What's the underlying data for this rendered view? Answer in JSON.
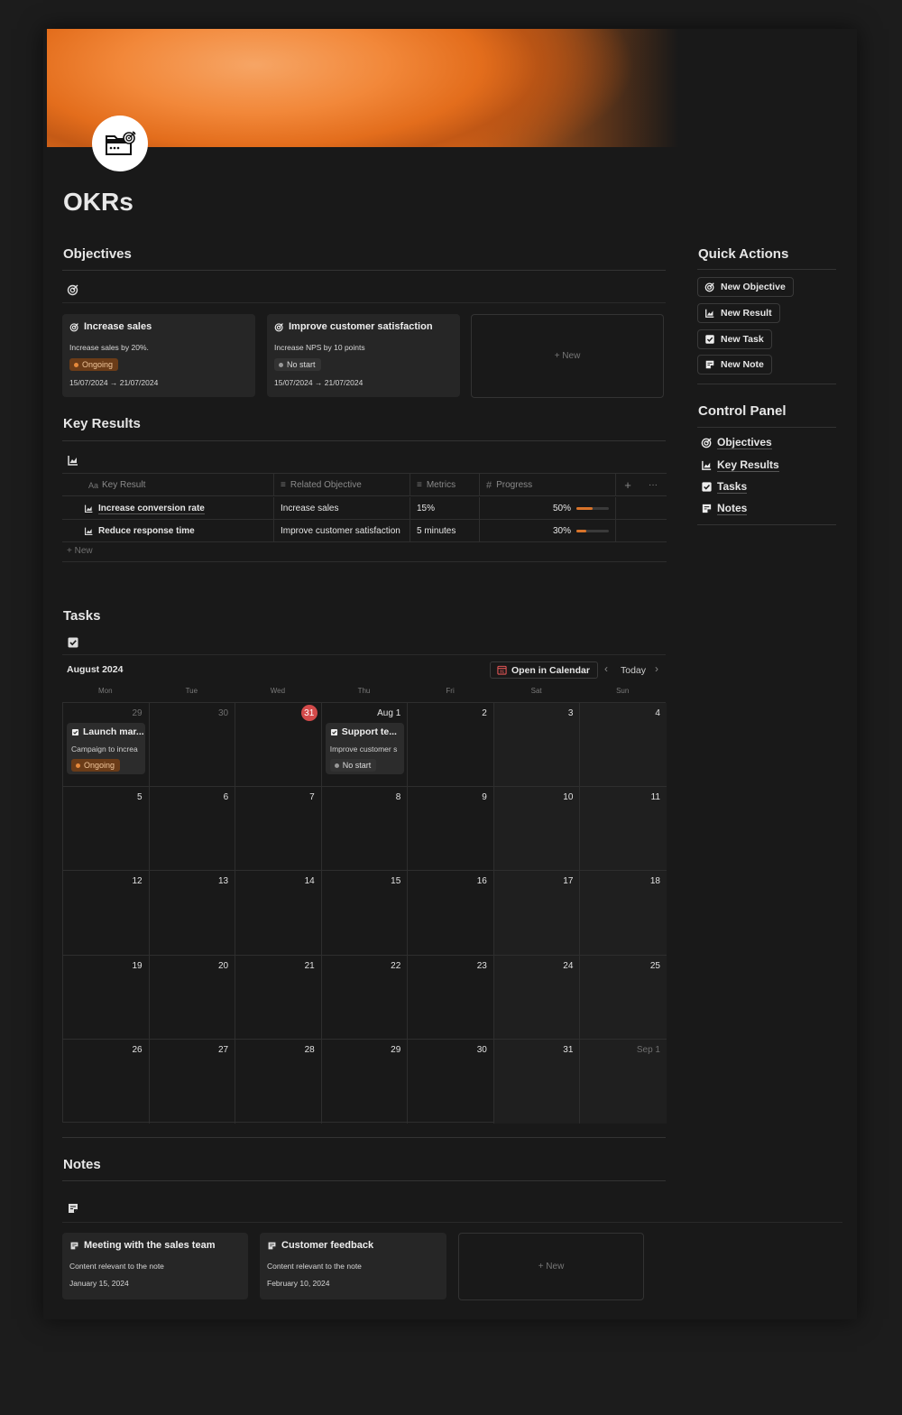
{
  "page": {
    "title": "OKRs"
  },
  "icons": [
    "okr-folder-icon",
    "target-icon",
    "chart-icon",
    "checkbox-icon",
    "note-icon",
    "calendar-icon",
    "plus-icon",
    "more-icon",
    "chevron-left-icon",
    "chevron-right-icon"
  ],
  "colors": {
    "accent": "#e5893b",
    "cover": "#e9741f",
    "today": "#d34a4a",
    "background": "#191919"
  },
  "objectives": {
    "heading": "Objectives",
    "cards": [
      {
        "title": "Increase sales",
        "description": "Increase sales by 20%.",
        "status": "Ongoing",
        "dates": "15/07/2024 → 21/07/2024"
      },
      {
        "title": "Improve customer satisfaction",
        "description": "Increase NPS by 10 points",
        "status": "No start",
        "dates": "15/07/2024 → 21/07/2024"
      }
    ],
    "new_label": "+ New"
  },
  "key_results": {
    "heading": "Key Results",
    "columns": {
      "name": "Key Result",
      "objective": "Related Objective",
      "metrics": "Metrics",
      "progress": "Progress",
      "name_prefix": "Aa"
    },
    "rows": [
      {
        "name": "Increase conversion rate",
        "objective": "Increase sales",
        "metrics": "15%",
        "progress_label": "50%",
        "progress": 0.5
      },
      {
        "name": "Reduce response time",
        "objective": "Improve customer satisfaction",
        "metrics": "5 minutes",
        "progress_label": "30%",
        "progress": 0.3
      }
    ],
    "new_label": "+ New",
    "add_label": "+",
    "more_label": "···"
  },
  "tasks": {
    "heading": "Tasks",
    "month": "August 2024",
    "open_calendar": "Open in Calendar",
    "today": "Today",
    "weekdays": [
      "Mon",
      "Tue",
      "Wed",
      "Thu",
      "Fri",
      "Sat",
      "Sun"
    ],
    "weeks": [
      [
        "29",
        "30",
        "31",
        "Aug 1",
        "2",
        "3",
        "4"
      ],
      [
        "5",
        "6",
        "7",
        "8",
        "9",
        "10",
        "11"
      ],
      [
        "12",
        "13",
        "14",
        "15",
        "16",
        "17",
        "18"
      ],
      [
        "19",
        "20",
        "21",
        "22",
        "23",
        "24",
        "25"
      ],
      [
        "26",
        "27",
        "28",
        "29",
        "30",
        "31",
        "Sep 1"
      ]
    ],
    "events": [
      {
        "title": "Launch mar...",
        "description": "Campaign to increa",
        "status": "Ongoing"
      },
      {
        "title": "Support te...",
        "description": "Improve customer s",
        "status": "No start"
      }
    ]
  },
  "notes": {
    "heading": "Notes",
    "cards": [
      {
        "title": "Meeting with the sales team",
        "content": "Content relevant to the note",
        "date": "January 15, 2024"
      },
      {
        "title": "Customer feedback",
        "content": "Content relevant to the note",
        "date": "February 10, 2024"
      }
    ],
    "new_label": "+ New"
  },
  "quick_actions": {
    "heading": "Quick Actions",
    "buttons": [
      "New Objective",
      "New Result",
      "New Task",
      "New Note"
    ]
  },
  "control_panel": {
    "heading": "Control Panel",
    "items": [
      "Objectives",
      "Key Results",
      "Tasks",
      "Notes"
    ]
  }
}
